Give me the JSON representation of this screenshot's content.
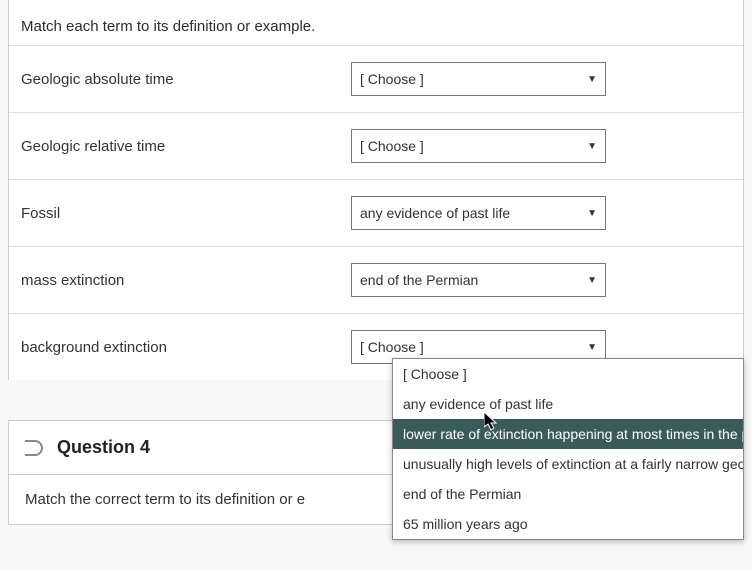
{
  "instruction": "Match each term to its definition or example.",
  "placeholder": "[ Choose ]",
  "terms": {
    "t0": {
      "label": "Geologic absolute time",
      "value": "[ Choose ]"
    },
    "t1": {
      "label": "Geologic relative time",
      "value": "[ Choose ]"
    },
    "t2": {
      "label": "Fossil",
      "value": "any evidence of past life"
    },
    "t3": {
      "label": "mass extinction",
      "value": "end of the Permian"
    },
    "t4": {
      "label": "background extinction",
      "value": "[ Choose ]"
    }
  },
  "dropdown": {
    "items": [
      "[ Choose ]",
      "any evidence of past life",
      "lower rate of extinction happening at most times in the past",
      "unusually high levels of extinction at a fairly narrow geologic time point",
      "end of the Permian",
      "65 million years ago"
    ],
    "selected_index": 2
  },
  "question4": {
    "title": "Question 4",
    "body": "Match the correct term to its definition or e"
  }
}
